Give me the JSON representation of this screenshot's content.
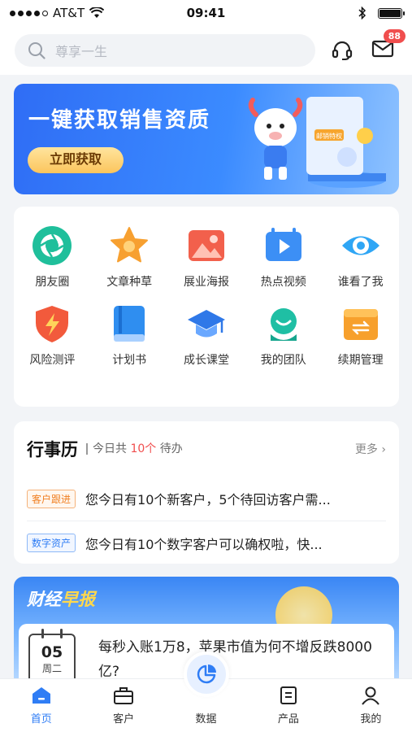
{
  "status_bar": {
    "carrier": "AT&T",
    "time": "09:41"
  },
  "header": {
    "search_placeholder": "尊享一生",
    "message_badge": "88"
  },
  "banner": {
    "title": "一键获取销售资质",
    "button_label": "立即获取",
    "card_label": "邮销特权"
  },
  "grid": {
    "items": [
      {
        "label": "朋友圈",
        "icon": "camera-shutter-icon"
      },
      {
        "label": "文章种草",
        "icon": "star-icon"
      },
      {
        "label": "展业海报",
        "icon": "image-icon"
      },
      {
        "label": "热点视频",
        "icon": "video-play-icon"
      },
      {
        "label": "谁看了我",
        "icon": "eye-icon"
      },
      {
        "label": "风险测评",
        "icon": "shield-lightning-icon"
      },
      {
        "label": "计划书",
        "icon": "book-icon"
      },
      {
        "label": "成长课堂",
        "icon": "graduation-cap-icon"
      },
      {
        "label": "我的团队",
        "icon": "team-icon"
      },
      {
        "label": "续期管理",
        "icon": "folder-icon"
      }
    ]
  },
  "schedule": {
    "title": "行事历",
    "sub_prefix": "今日共",
    "count": "10个",
    "sub_suffix": "待办",
    "more": "更多",
    "rows": [
      {
        "tag": "客户跟进",
        "text": "您今日有10个新客户，5个待回访客户需..."
      },
      {
        "tag": "数字资产",
        "text": "您今日有10个数字客户可以确权啦，快..."
      }
    ]
  },
  "finance": {
    "title_part1": "财经",
    "title_part2": "早报",
    "day": "05",
    "weekday": "周二",
    "headline": "每秒入账1万8，苹果市值为何不增反跌8000亿?"
  },
  "tabbar": {
    "tabs": [
      {
        "label": "首页",
        "active": true
      },
      {
        "label": "客户"
      },
      {
        "label": "数据"
      },
      {
        "label": "产品"
      },
      {
        "label": "我的"
      }
    ]
  },
  "colors": {
    "accent": "#2f7df5",
    "badge": "#f04e4e",
    "banner_button": "#fbc55c"
  }
}
